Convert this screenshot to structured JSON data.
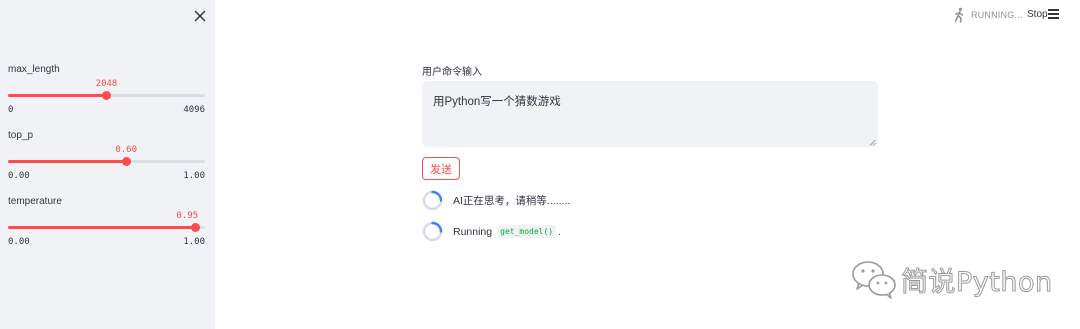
{
  "sidebar": {
    "close_icon": "close-icon",
    "sliders": [
      {
        "label": "max_length",
        "value": "2048",
        "min": "0",
        "max": "4096",
        "fraction": 0.5
      },
      {
        "label": "top_p",
        "value": "0.60",
        "min": "0.00",
        "max": "1.00",
        "fraction": 0.6
      },
      {
        "label": "temperature",
        "value": "0.95",
        "min": "0.00",
        "max": "1.00",
        "fraction": 0.95
      }
    ]
  },
  "header": {
    "status_icon": "running-man-icon",
    "status_text": "RUNNING...",
    "stop_label": "Stop",
    "menu_icon": "hamburger-menu-icon"
  },
  "main": {
    "input_label": "用户命令输入",
    "input_value": "用Python写一个猜数游戏",
    "send_label": "发送",
    "status_lines": [
      {
        "text": "AI正在思考，请稍等........"
      },
      {
        "prefix": "Running",
        "code": "get_model()",
        "suffix": "."
      }
    ]
  },
  "watermark": {
    "text": "简说Python"
  },
  "colors": {
    "accent": "#ff4b4b",
    "sidebar_bg": "#f0f2f6",
    "spinner": "#3b82f6",
    "code": "#09ab3b"
  }
}
